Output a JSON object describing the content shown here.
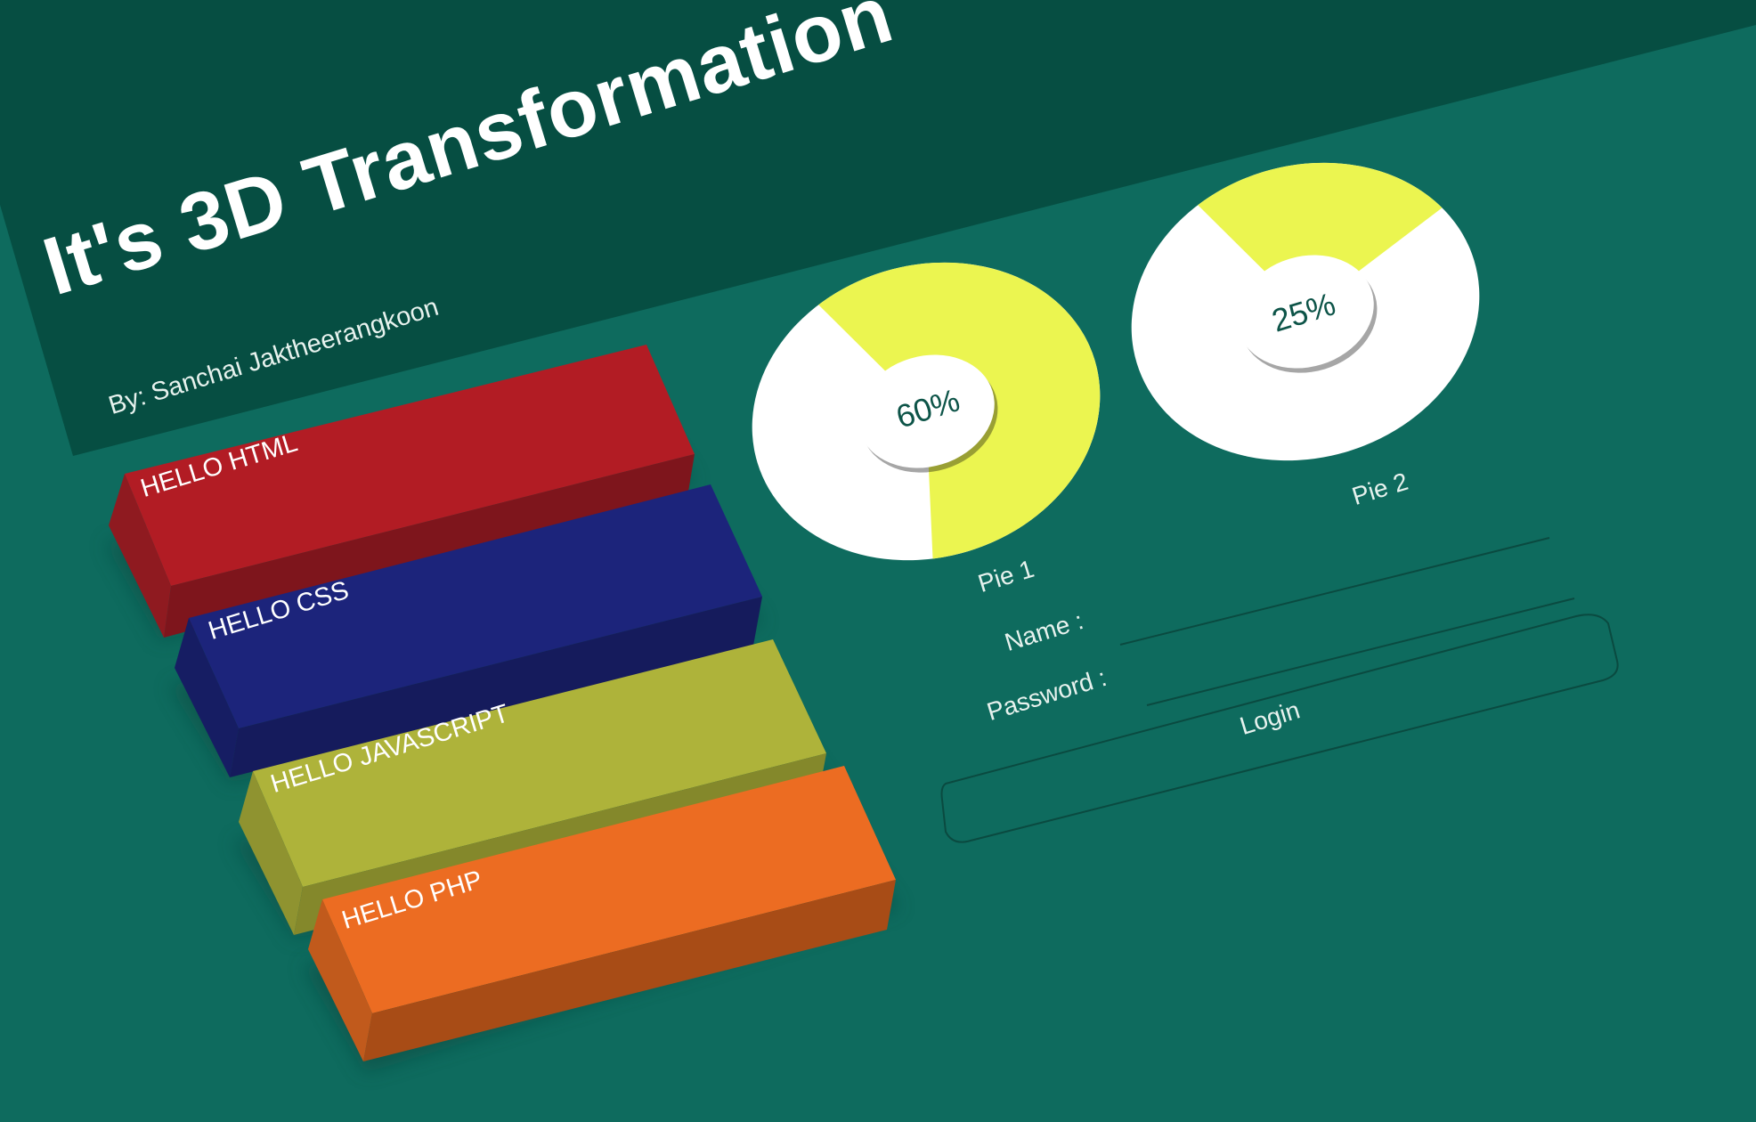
{
  "header": {
    "title": "It's 3D Transformation",
    "subtitle": "By: Sanchai Jaktheerangkoon"
  },
  "blocks": [
    {
      "label": "HELLO HTML",
      "color": "#b21c24"
    },
    {
      "label": "HELLO CSS",
      "color": "#1c247b"
    },
    {
      "label": "HELLO JAVASCRIPT",
      "color": "#aeb33a"
    },
    {
      "label": "HELLO PHP",
      "color": "#ec6c22"
    }
  ],
  "pies": [
    {
      "name": "Pie 1",
      "percent_label": "60%",
      "fraction": 0.6
    },
    {
      "name": "Pie 2",
      "percent_label": "25%",
      "fraction": 0.25
    }
  ],
  "login_form": {
    "name_label": "Name :",
    "password_label": "Password :",
    "login_label": "Login"
  },
  "colors": {
    "background": "#0e6b5e",
    "header_band": "#064e42",
    "pie_fill": "#ebf550",
    "pie_base": "#ffffff"
  }
}
